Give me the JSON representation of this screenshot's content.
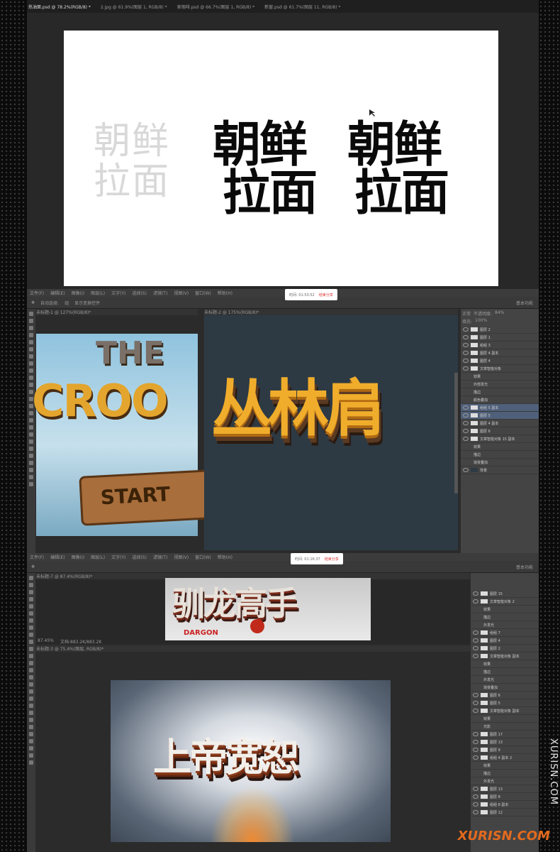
{
  "section1": {
    "tabs": [
      "热油面.psd @ 78.2%(RGB/8) *",
      "2.jpg @ 61.9%(图层 1, RGB/8) *",
      "家咖啡.psd @ 66.7%(图层 1, RGB/8) *",
      "新窗.psd @ 61.7%(图层 11, RGB/8) *"
    ],
    "sketch_text": [
      "朝鲜",
      "拉面"
    ],
    "bold_text_1": [
      "朝鲜",
      "拉面"
    ],
    "bold_text_2": [
      "朝鲜",
      "拉面"
    ]
  },
  "section2": {
    "menu": [
      "文件(F)",
      "编辑(E)",
      "图像(I)",
      "图层(L)",
      "文字(Y)",
      "选择(S)",
      "滤镜(T)",
      "视图(V)",
      "窗口(W)",
      "帮助(H)"
    ],
    "options": [
      "自动选择:",
      "组",
      "显示变换控件"
    ],
    "timer": {
      "label": "时间: 01:53:52",
      "stop": "结束分享"
    },
    "workspace": "基本功能",
    "doc1_tab": "未标题-1 @ 127%(RGB/8)*",
    "doc2_tab": "未标题-2 @ 175%(RGB/8)*",
    "doc1_logo": [
      "THE",
      "CROO",
      "START"
    ],
    "doc2_title": "丛林肩",
    "layers": {
      "blend": "正常",
      "opacity_label": "不透明度:",
      "opacity": "84%",
      "fill_label": "填充:",
      "fill": "100%",
      "rows": [
        "图层 2",
        "图层 1",
        "组组 3",
        "图层 4 副本",
        "图层 4",
        "文章智能对象",
        "效果",
        "外部发光",
        "描边",
        "颜色叠加",
        "组组 5 副本",
        "图层 5",
        "图层 4 副本",
        "图层 6",
        "文章智能对象 15 副本",
        "效果",
        "描边",
        "渐变叠加",
        "背景"
      ]
    }
  },
  "section3": {
    "menu": [
      "文件(F)",
      "编辑(E)",
      "图像(I)",
      "图层(L)",
      "文字(Y)",
      "选择(S)",
      "滤镜(T)",
      "视图(V)",
      "窗口(W)",
      "帮助(H)"
    ],
    "timer": {
      "label": "时间: 01:16:37",
      "stop": "结束分享"
    },
    "workspace": "基本功能",
    "doc1_tab": "未标题-7 @ 87.4%(RGB/8)*",
    "doc1_title": "驯龙高手",
    "doc1_sub": "DARGON",
    "status": "87.45%",
    "status_doc": "文档:883.2K/883.2K",
    "doc2_tab": "未标题-3 @ 75.4%(图层, RGB/8)*",
    "doc2_title": "上帝宽恕",
    "layers": {
      "rows": [
        "图层 15",
        "文章智能对象 2",
        "效果",
        "描边",
        "外发光",
        "组组 7",
        "图层 4",
        "图层 2",
        "文章智能对象 副本",
        "效果",
        "描边",
        "外发光",
        "渐变叠加",
        "图层 6",
        "图层 5",
        "文章智能对象 副本",
        "效果",
        "光影",
        "图层 17",
        "图层 13",
        "图层 9",
        "组组 4 副本 2",
        "效果",
        "描边",
        "外发光",
        "图层 13",
        "图层 8",
        "组组 8 副本",
        "图层 12"
      ]
    }
  },
  "watermark": "XURISN.COM",
  "watermark2": "XURISN.COM"
}
